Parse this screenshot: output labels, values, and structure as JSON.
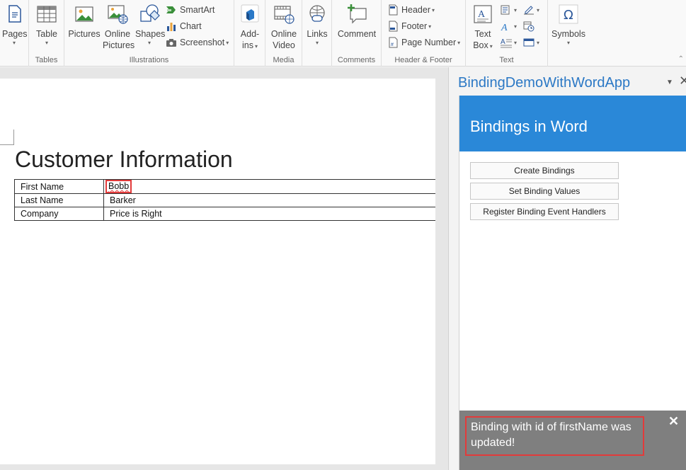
{
  "ribbon": {
    "pages": {
      "label": "Pages"
    },
    "tables": {
      "table_label": "Table",
      "group_label": "Tables"
    },
    "illustrations": {
      "pictures_label": "Pictures",
      "online_pictures_label_1": "Online",
      "online_pictures_label_2": "Pictures",
      "shapes_label": "Shapes",
      "smartart_label": "SmartArt",
      "chart_label": "Chart",
      "screenshot_label": "Screenshot",
      "group_label": "Illustrations"
    },
    "addins": {
      "label_1": "Add-",
      "label_2": "ins"
    },
    "media": {
      "video_label_1": "Online",
      "video_label_2": "Video",
      "group_label": "Media"
    },
    "links": {
      "label": "Links"
    },
    "comments": {
      "comment_label": "Comment",
      "group_label": "Comments"
    },
    "header_footer": {
      "header_label": "Header",
      "footer_label": "Footer",
      "page_number_label": "Page Number",
      "group_label": "Header & Footer"
    },
    "text": {
      "textbox_label_1": "Text",
      "textbox_label_2": "Box",
      "group_label": "Text"
    },
    "symbols": {
      "label": "Symbols"
    }
  },
  "document": {
    "heading": "Customer Information",
    "table": [
      {
        "field": "First Name",
        "value": "Bobb"
      },
      {
        "field": "Last Name",
        "value": "Barker"
      },
      {
        "field": "Company",
        "value": "Price is Right"
      }
    ]
  },
  "taskpane": {
    "title": "BindingDemoWithWordApp",
    "header": "Bindings in Word",
    "buttons": [
      "Create Bindings",
      "Set Binding Values",
      "Register Binding Event Handlers"
    ],
    "notification": "Binding with id of firstName was updated!"
  },
  "colors": {
    "accent": "#2a88d8",
    "pane_title": "#2b78c5",
    "highlight": "#e23b3b",
    "notification_bg": "#7f7f7f"
  },
  "icons": [
    "pages-icon",
    "table-icon",
    "pictures-icon",
    "online-pictures-icon",
    "shapes-icon",
    "smartart-icon",
    "chart-icon",
    "screenshot-icon",
    "store-icon",
    "online-video-icon",
    "links-icon",
    "comment-icon",
    "header-icon",
    "footer-icon",
    "page-number-icon",
    "textbox-icon",
    "quick-parts-icon",
    "wordart-icon",
    "dropcap-icon",
    "signature-icon",
    "datetime-icon",
    "object-icon",
    "omega-icon",
    "close-icon"
  ]
}
